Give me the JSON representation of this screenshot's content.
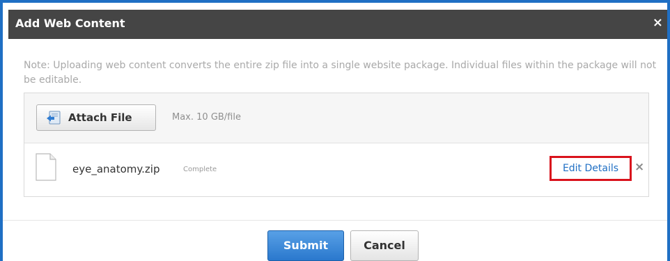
{
  "dialog": {
    "title": "Add Web Content",
    "close_label": "×",
    "note": "Note: Uploading web content converts the entire zip file into a single website package. Individual files within the package will not be editable."
  },
  "upload": {
    "attach_label": "Attach File",
    "attach_icon": "attach-file-icon",
    "max_size": "Max. 10 GB/file"
  },
  "file": {
    "icon": "document-icon",
    "name": "eye_anatomy.zip",
    "status": "Complete",
    "edit_label": "Edit Details",
    "remove_label": "×"
  },
  "footer": {
    "submit_label": "Submit",
    "cancel_label": "Cancel"
  },
  "colors": {
    "titlebar": "#454545",
    "accent": "#1f6fc4",
    "highlight": "#d9121c",
    "note_text": "#a9a9a9"
  }
}
